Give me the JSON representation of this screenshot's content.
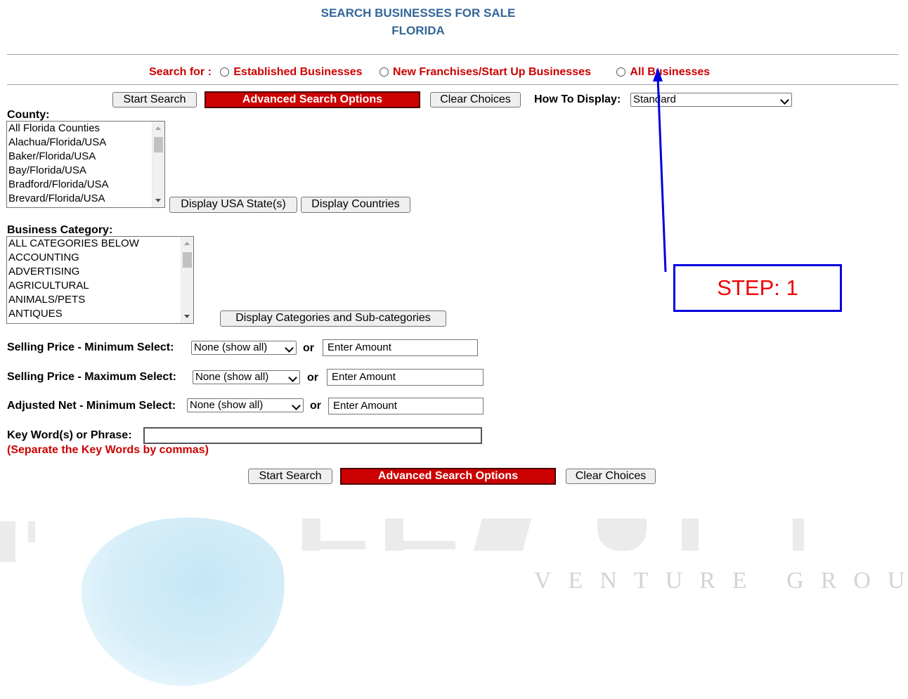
{
  "header": {
    "title_line1": "SEARCH BUSINESSES FOR SALE",
    "title_line2": "FLORIDA"
  },
  "search_for": {
    "label": "Search for :",
    "options": [
      "Established Businesses",
      "New Franchises/Start Up Businesses",
      "All Businesses"
    ]
  },
  "toolbar": {
    "start_search": "Start Search",
    "advanced_options": "Advanced Search Options",
    "clear_choices": "Clear Choices",
    "display_label": "How To Display:",
    "display_value": "Standard"
  },
  "county": {
    "label": "County:",
    "items": [
      "All Florida Counties",
      "Alachua/Florida/USA",
      "Baker/Florida/USA",
      "Bay/Florida/USA",
      "Bradford/Florida/USA",
      "Brevard/Florida/USA"
    ],
    "btn_states": "Display USA State(s)",
    "btn_countries": "Display Countries"
  },
  "category": {
    "label": "Business Category:",
    "items": [
      "ALL CATEGORIES BELOW",
      "ACCOUNTING",
      "ADVERTISING",
      "AGRICULTURAL",
      "ANIMALS/PETS",
      "ANTIQUES"
    ],
    "btn_display": "Display Categories and Sub-categories"
  },
  "filters": {
    "or": "or",
    "price_min_label": "Selling Price - Minimum Select:",
    "price_max_label": "Selling Price - Maximum Select:",
    "net_min_label": "Adjusted Net - Minimum Select:",
    "select_value": "None (show all)",
    "amount_placeholder": "Enter Amount"
  },
  "keywords": {
    "label": "Key Word(s) or Phrase:",
    "value": "",
    "note": "(Separate the Key Words by commas)"
  },
  "annotation": {
    "step": "STEP: 1",
    "color": "#0000dd"
  },
  "colors": {
    "title": "#336699",
    "accent_red": "#cc0000"
  }
}
